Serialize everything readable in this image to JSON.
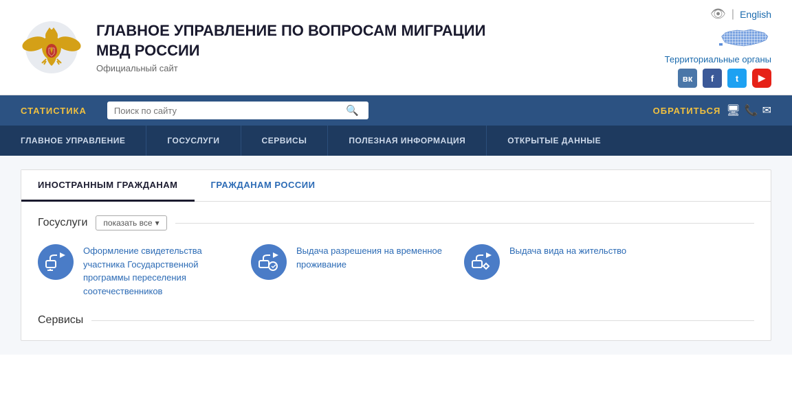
{
  "header": {
    "title": "ГЛАВНОЕ УПРАВЛЕНИЕ ПО ВОПРОСАМ МИГРАЦИИ МВД РОССИИ",
    "subtitle": "Официальный сайт",
    "english_label": "English",
    "territorial_label": "Территориальные органы",
    "eye_icon": "👁",
    "separator": "|"
  },
  "nav1": {
    "stat_label": "СТАТИСТИКА",
    "search_placeholder": "Поиск по сайту",
    "contact_label": "ОБРАТИТЬСЯ"
  },
  "nav2": {
    "items": [
      "ГЛАВНОЕ УПРАВЛЕНИЕ",
      "ГОСУСЛУГИ",
      "СЕРВИСЫ",
      "ПОЛЕЗНАЯ ИНФОРМАЦИЯ",
      "ОТКРЫТЫЕ ДАННЫЕ"
    ]
  },
  "tabs": {
    "items": [
      {
        "label": "ИНОСТРАННЫМ ГРАЖДАНАМ",
        "active": true
      },
      {
        "label": "ГРАЖДАНАМ РОССИИ",
        "active": false
      }
    ]
  },
  "gosuslugi": {
    "label": "Госуслуги",
    "show_all": "показать все",
    "services": [
      {
        "text": "Оформление свидетельства участника Государственной программы переселения соотечественников"
      },
      {
        "text": "Выдача разрешения на временное проживание"
      },
      {
        "text": "Выдача вида на жительство"
      }
    ]
  },
  "servisy": {
    "label": "Сервисы"
  },
  "social": {
    "vk": "вк",
    "fb": "f",
    "tw": "t",
    "yt": "▶"
  }
}
